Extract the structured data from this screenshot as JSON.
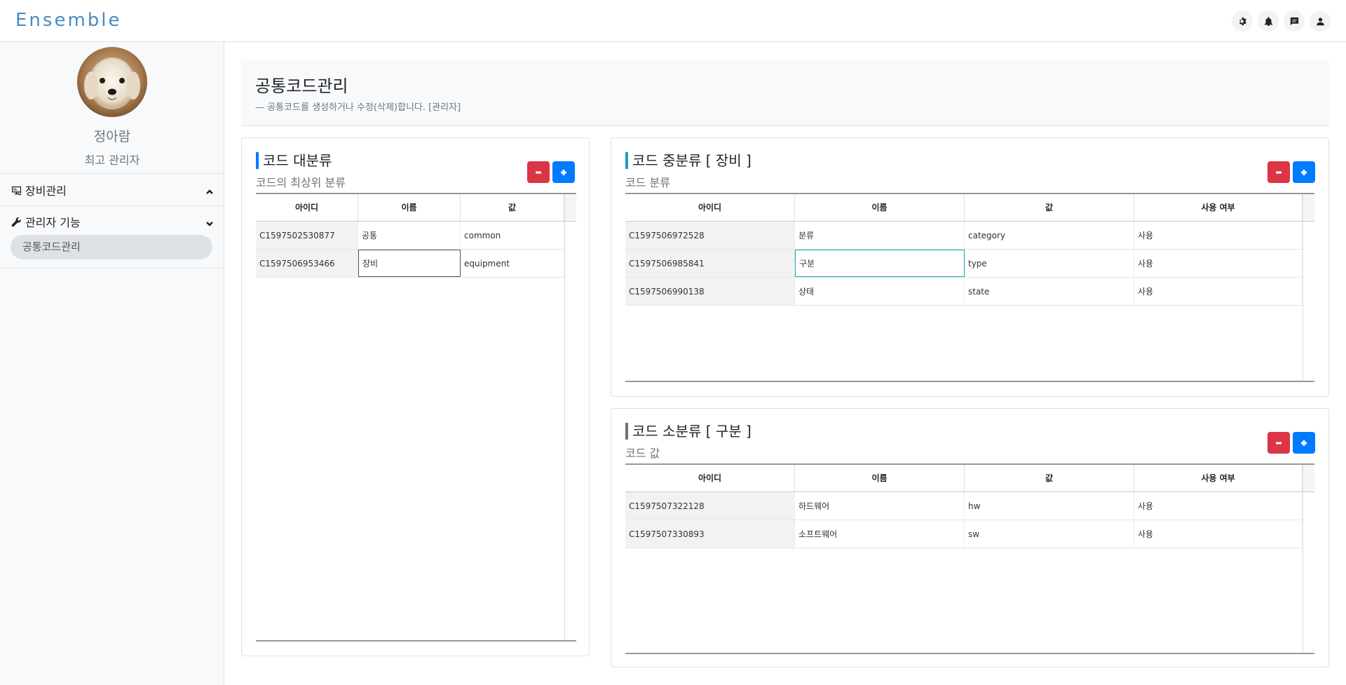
{
  "brand": "Ensemble",
  "top_icons": [
    "gear-icon",
    "bell-icon",
    "chat-icon",
    "user-icon"
  ],
  "user": {
    "name": "정아람",
    "role": "최고 관리자"
  },
  "menu": {
    "equipment": {
      "label": "장비관리"
    },
    "admin": {
      "label": "관리자 기능",
      "sub_active": "공통코드관리"
    }
  },
  "page": {
    "title": "공통코드관리",
    "subtitle": "— 공통코드를 생성하거나 수정(삭제)합니다. [관리자]"
  },
  "major": {
    "title": "코드 대분류",
    "subtitle": "코드의 최상위 분류",
    "headers": [
      "아이디",
      "이름",
      "값"
    ],
    "rows": [
      [
        "C1597502530877",
        "공통",
        "common"
      ],
      [
        "C1597506953466",
        "장비",
        "equipment"
      ]
    ]
  },
  "middle": {
    "title": "코드 중분류 [ 장비 ]",
    "subtitle": "코드 분류",
    "headers": [
      "아이디",
      "이름",
      "값",
      "사용 여부"
    ],
    "rows": [
      [
        "C1597506972528",
        "분류",
        "category",
        "사용"
      ],
      [
        "C1597506985841",
        "구분",
        "type",
        "사용"
      ],
      [
        "C1597506990138",
        "상태",
        "state",
        "사용"
      ]
    ]
  },
  "minor": {
    "title": "코드 소분류 [ 구분 ]",
    "subtitle": "코드 값",
    "headers": [
      "아이디",
      "이름",
      "값",
      "사용 여부"
    ],
    "rows": [
      [
        "C1597507322128",
        "하드웨어",
        "hw",
        "사용"
      ],
      [
        "C1597507330893",
        "소프트웨어",
        "sw",
        "사용"
      ]
    ]
  },
  "colors": {
    "brand": "#4a8ac4",
    "danger": "#dc3545",
    "primary": "#007bff",
    "accent": "#17a2b8"
  }
}
